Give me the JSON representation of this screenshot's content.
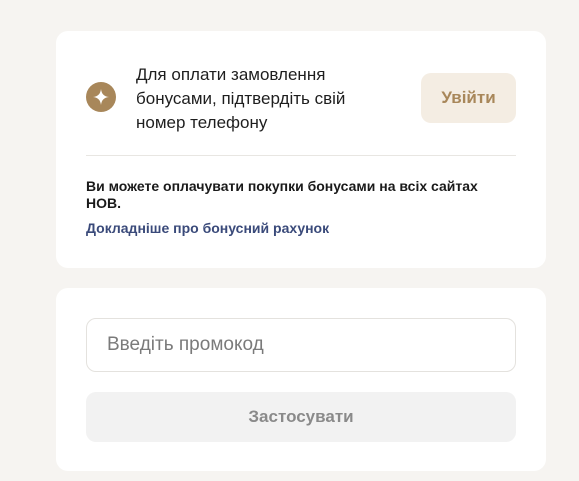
{
  "bonus": {
    "icon": "sparkle-icon",
    "prompt_line1": "Для оплати замовлення",
    "prompt_line2": "бонусами, підтвердіть свій",
    "prompt_line3": "номер телефону",
    "login_label": "Увійти",
    "info_text": "Ви можете оплачувати покупки бонусами на всіх сайтах НОВ.",
    "link_text": "Докладніше про бонусний рахунок"
  },
  "promo": {
    "input_value": "",
    "input_placeholder": "Введіть промокод",
    "apply_label": "Застосувати"
  },
  "colors": {
    "accent": "#a8875a",
    "accent_bg": "#f4ede3",
    "link": "#3a4a7a",
    "page_bg": "#f6f4f1"
  }
}
